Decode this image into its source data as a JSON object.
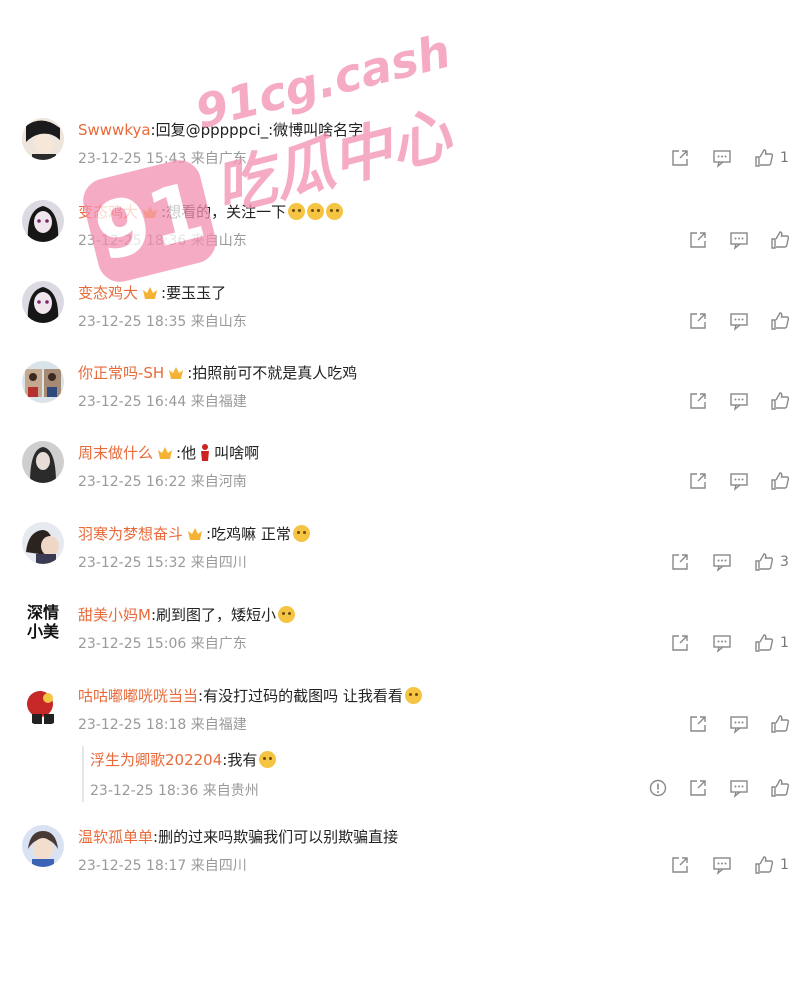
{
  "comments": [
    {
      "user": "Swwwkya",
      "text": ":回复@pppppci_:微博叫啥名字",
      "date": "23-12-25 15:43",
      "location": "来自广东",
      "likes": "1"
    },
    {
      "user": "变态鸡大",
      "text": ":想看的，关注一下",
      "date": "23-12-25 18:36",
      "location": "来自山东",
      "likes": ""
    },
    {
      "user": "变态鸡大",
      "text": ":要玉玉了",
      "date": "23-12-25 18:35",
      "location": "来自山东",
      "likes": ""
    },
    {
      "user": "你正常吗-SH",
      "text": ":拍照前可不就是真人吃鸡",
      "date": "23-12-25 16:44",
      "location": "来自福建",
      "likes": ""
    },
    {
      "user": "周末做什么",
      "text_before": ":他",
      "text_after": "叫啥啊",
      "date": "23-12-25 16:22",
      "location": "来自河南",
      "likes": ""
    },
    {
      "user": "羽寒为梦想奋斗",
      "text": ":吃鸡嘛 正常",
      "date": "23-12-25 15:32",
      "location": "来自四川",
      "likes": "3"
    },
    {
      "user": "甜美小妈M",
      "avatar_text": "深情小美",
      "text": ":刷到图了，矮短小",
      "date": "23-12-25 15:06",
      "location": "来自广东",
      "likes": "1"
    },
    {
      "user": "咕咕嘟嘟咣咣当当",
      "text": ":有没打过码的截图吗 让我看看",
      "date": "23-12-25 18:18",
      "location": "来自福建",
      "likes": "",
      "reply": {
        "user": "浮生为卿歌202204",
        "text": ":我有",
        "date": "23-12-25 18:36",
        "location": "来自贵州"
      }
    },
    {
      "user": "温软孤单单",
      "text": ":删的过来吗欺骗我们可以别欺骗直接",
      "date": "23-12-25 18:17",
      "location": "来自四川",
      "likes": "1"
    }
  ],
  "watermark": {
    "top": "91cg.cash",
    "logo": "91",
    "bottom": "吃瓜中心",
    "color": "#f48fb1"
  },
  "icons": {
    "share": "share-icon",
    "comment": "comment-icon",
    "like": "like-icon",
    "report": "report-icon"
  }
}
